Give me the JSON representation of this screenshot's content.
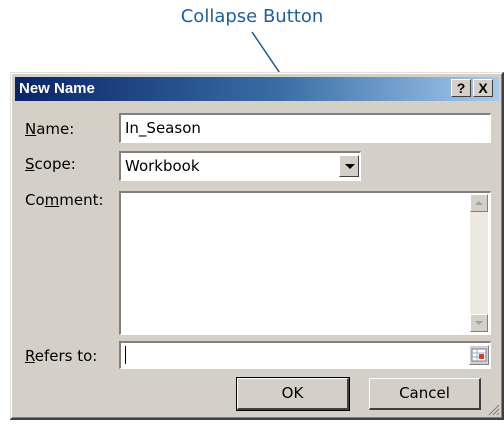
{
  "callout": {
    "label": "Collapse Button"
  },
  "dialog": {
    "title": "New Name",
    "help_button": "?",
    "close_button": "X",
    "name": {
      "label": "Name:",
      "mnemonic": "N",
      "rest": "ame:",
      "value": "In_Season"
    },
    "scope": {
      "label": "Scope:",
      "mnemonic": "S",
      "rest": "cope:",
      "value": "Workbook"
    },
    "comment": {
      "label": "Comment:",
      "pre": "Co",
      "mnemonic": "m",
      "rest": "ment:",
      "value": ""
    },
    "refers_to": {
      "label": "Refers to:",
      "mnemonic": "R",
      "rest": "efers to:",
      "value": ""
    },
    "ok_label": "OK",
    "cancel_label": "Cancel"
  },
  "colors": {
    "callout_text": "#1e5f9e",
    "leader_line": "#1a5a8a",
    "title_bar": "#0a246a",
    "dialog_face": "#d4d0c8"
  }
}
